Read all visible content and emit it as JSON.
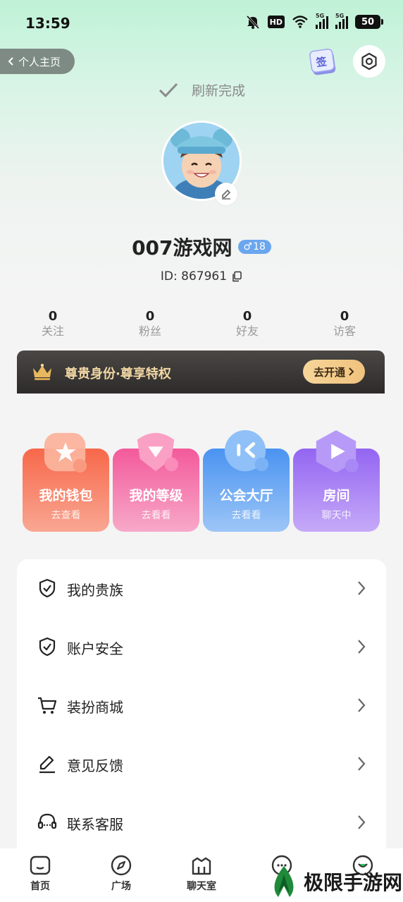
{
  "status_bar": {
    "time": "13:59",
    "battery": "50",
    "hd_label": "HD",
    "net1": "5G",
    "net2": "5G"
  },
  "header": {
    "back_label": "个人主页",
    "sign_label": "签"
  },
  "refresh": {
    "text": "刷新完成"
  },
  "profile": {
    "username": "007游戏网",
    "gender_symbol": "♂",
    "age": "18",
    "id_label": "ID: 867961"
  },
  "stats": [
    {
      "value": "0",
      "label": "关注"
    },
    {
      "value": "0",
      "label": "粉丝"
    },
    {
      "value": "0",
      "label": "好友"
    },
    {
      "value": "0",
      "label": "访客"
    }
  ],
  "vip": {
    "text": "尊贵身份·尊享特权",
    "button": "去开通"
  },
  "cards": [
    {
      "title": "我的钱包",
      "sub": "去查看",
      "color": "#f5755b"
    },
    {
      "title": "我的等级",
      "sub": "去看看",
      "color": "#f46aa3"
    },
    {
      "title": "公会大厅",
      "sub": "去看看",
      "color": "#5aa0f4"
    },
    {
      "title": "房间",
      "sub": "聊天中",
      "color": "#a77cf5"
    }
  ],
  "menu": [
    {
      "label": "我的贵族",
      "icon": "shield-icon"
    },
    {
      "label": "账户安全",
      "icon": "shield-check-icon"
    },
    {
      "label": "装扮商城",
      "icon": "cart-icon"
    },
    {
      "label": "意见反馈",
      "icon": "pen-icon"
    },
    {
      "label": "联系客服",
      "icon": "headset-icon"
    }
  ],
  "tabbar": [
    {
      "label": "首页",
      "icon": "home-icon"
    },
    {
      "label": "广场",
      "icon": "compass-icon"
    },
    {
      "label": "聊天室",
      "icon": "chatroom-icon"
    },
    {
      "label": "",
      "icon": "message-icon"
    },
    {
      "label": "",
      "icon": "profile-icon"
    }
  ],
  "watermark": {
    "text": "极限手游网"
  }
}
